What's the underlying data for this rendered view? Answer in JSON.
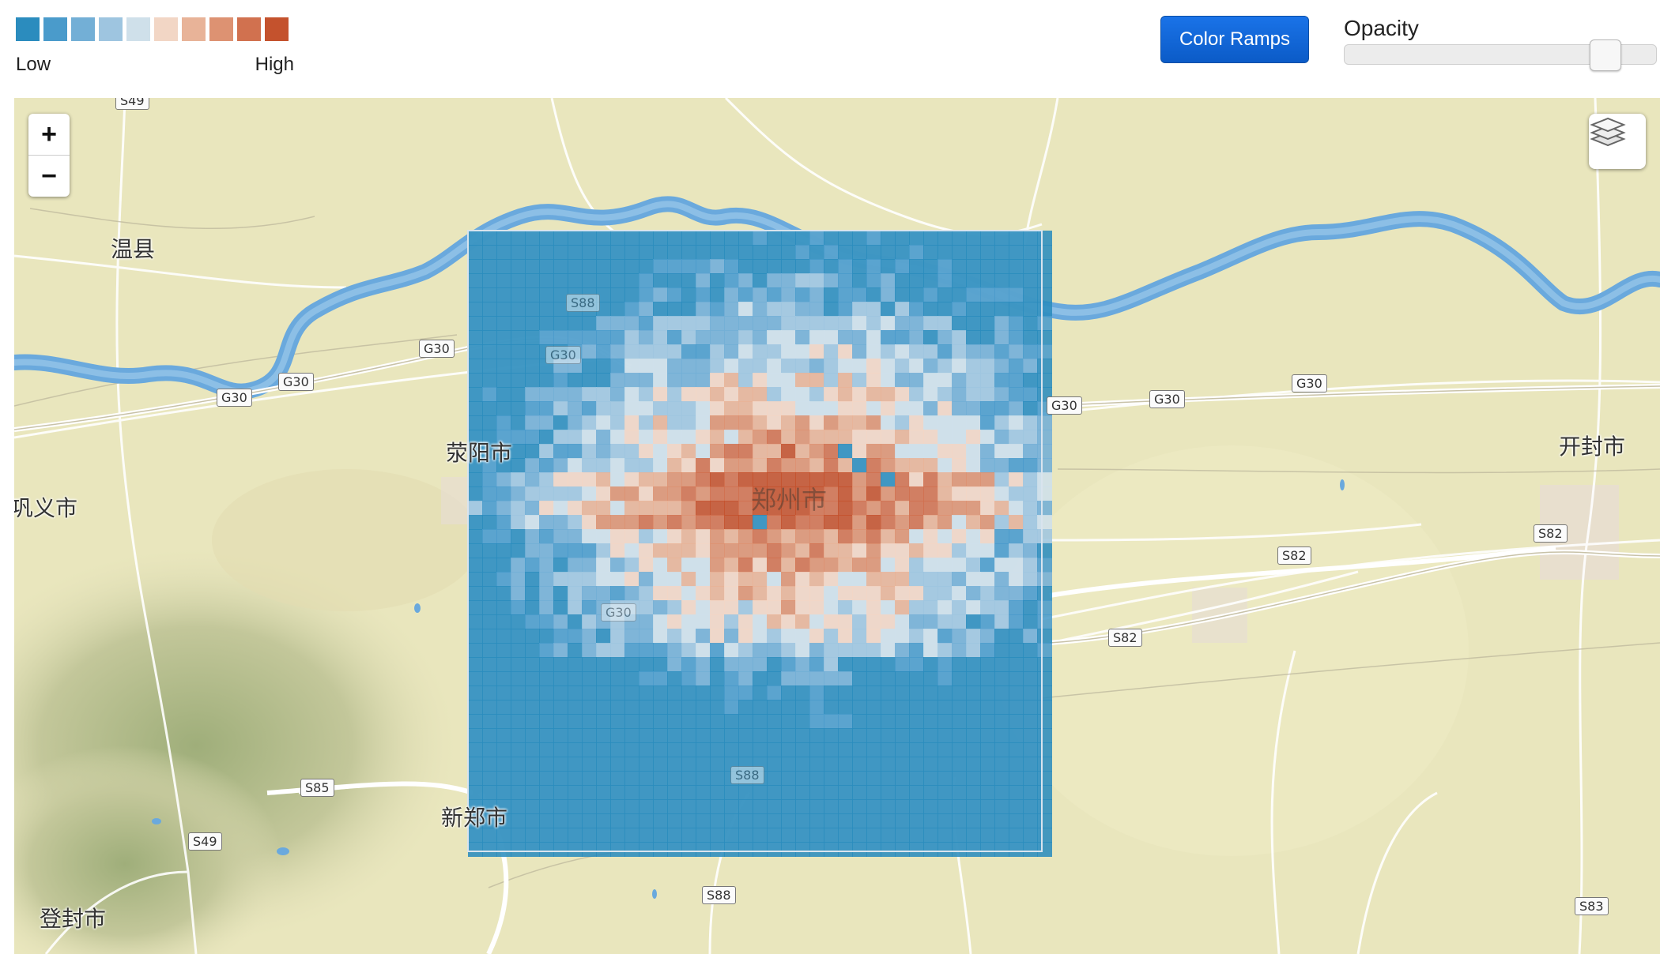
{
  "legend": {
    "colors": [
      "#2b8cbe",
      "#4a9bcb",
      "#73afd6",
      "#9ec5e0",
      "#cfe0ea",
      "#f2d6c5",
      "#e8b398",
      "#dd9272",
      "#d1714f",
      "#c4522d"
    ],
    "low_label": "Low",
    "high_label": "High"
  },
  "controls": {
    "color_ramps_label": "Color Ramps",
    "opacity_label": "Opacity",
    "opacity_value": 0.87
  },
  "map": {
    "zoom_in_label": "+",
    "zoom_out_label": "−",
    "layers_icon": "layers-icon",
    "places": [
      {
        "id": "wenxian",
        "name": "温县"
      },
      {
        "id": "xingyang",
        "name": "荥阳市"
      },
      {
        "id": "gongyi",
        "name": "巩义市"
      },
      {
        "id": "zhengzhou",
        "name": "郑州市"
      },
      {
        "id": "kaifeng",
        "name": "开封市"
      },
      {
        "id": "xinzheng",
        "name": "新郑市"
      },
      {
        "id": "dengfeng",
        "name": "登封市"
      }
    ],
    "road_labels": [
      {
        "id": "s49-top",
        "text": "S49"
      },
      {
        "id": "g30-a",
        "text": "G30"
      },
      {
        "id": "g30-b",
        "text": "G30"
      },
      {
        "id": "g30-c",
        "text": "G30"
      },
      {
        "id": "g30-d",
        "text": "G30"
      },
      {
        "id": "g30-e",
        "text": "G30"
      },
      {
        "id": "g30-f",
        "text": "G30"
      },
      {
        "id": "s82-a",
        "text": "S82"
      },
      {
        "id": "s82-b",
        "text": "S82"
      },
      {
        "id": "s82-c",
        "text": "S82"
      },
      {
        "id": "s85",
        "text": "S85"
      },
      {
        "id": "s49-bottom",
        "text": "S49"
      },
      {
        "id": "s88-bottom",
        "text": "S88"
      },
      {
        "id": "s83",
        "text": "S83"
      },
      {
        "id": "s88-ov1",
        "text": "S88"
      },
      {
        "id": "g30-ov",
        "text": "G30"
      },
      {
        "id": "g30-ov2",
        "text": "G30"
      },
      {
        "id": "s88-ov2",
        "text": "S88"
      }
    ]
  }
}
